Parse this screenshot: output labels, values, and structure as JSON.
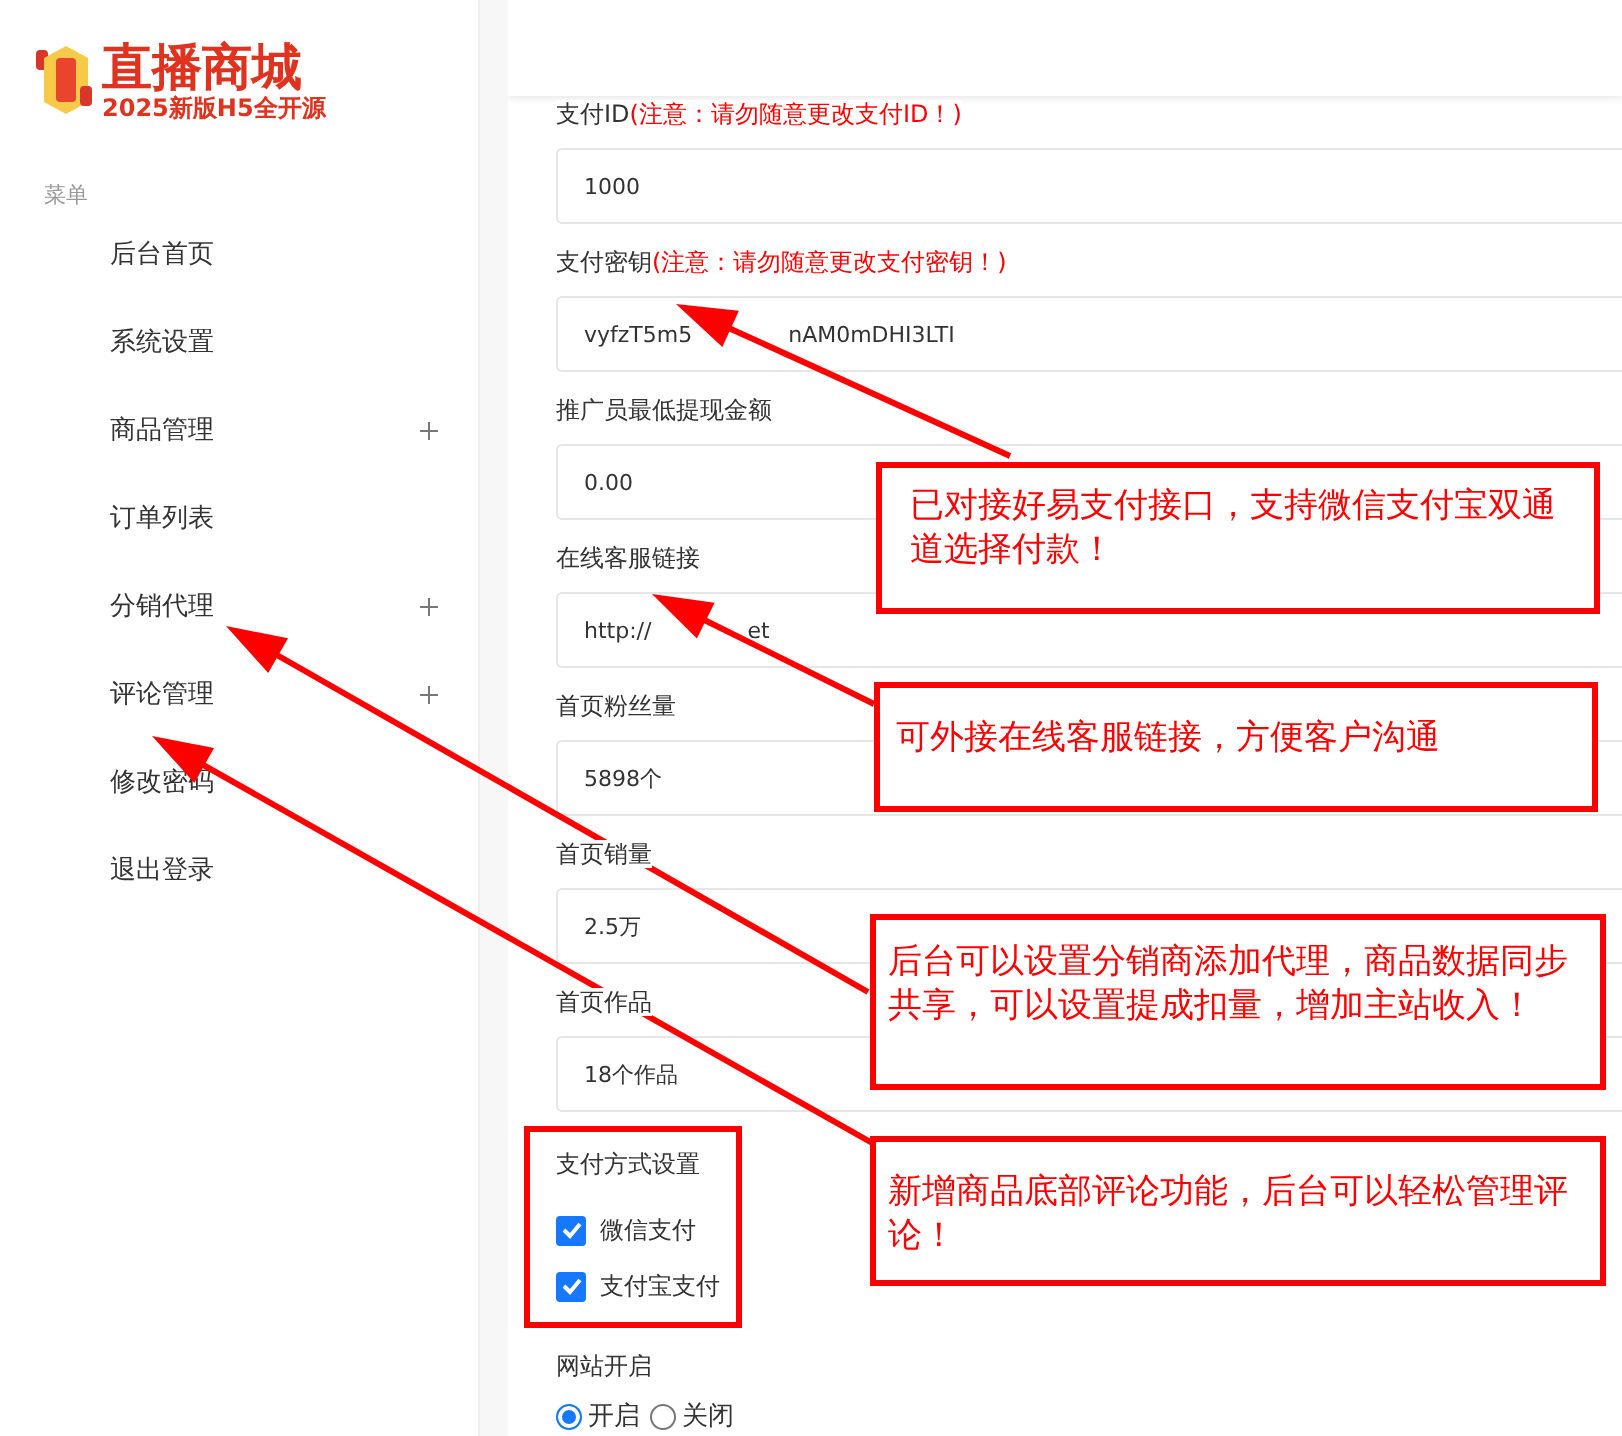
{
  "logo": {
    "title": "直播商城",
    "subtitle": "2025新版H5全开源"
  },
  "sidebar": {
    "heading": "菜单",
    "items": [
      {
        "label": "后台首页",
        "expandable": false
      },
      {
        "label": "系统设置",
        "expandable": false
      },
      {
        "label": "商品管理",
        "expandable": true
      },
      {
        "label": "订单列表",
        "expandable": false
      },
      {
        "label": "分销代理",
        "expandable": true
      },
      {
        "label": "评论管理",
        "expandable": true
      },
      {
        "label": "修改密码",
        "expandable": false
      },
      {
        "label": "退出登录",
        "expandable": false
      }
    ]
  },
  "form": {
    "fields": [
      {
        "label": "支付ID",
        "note": "(注意：请勿随意更改支付ID！)",
        "value_parts": [
          "1000"
        ]
      },
      {
        "label": "支付密钥",
        "note": "(注意：请勿随意更改支付密钥！)",
        "value_parts": [
          "vyfzT5m5",
          "nAM0mDHI3LTI"
        ]
      },
      {
        "label": "推广员最低提现金额",
        "value_parts": [
          "0.00"
        ]
      },
      {
        "label": "在线客服链接",
        "value_parts": [
          "http://",
          "et"
        ]
      },
      {
        "label": "首页粉丝量",
        "value_parts": [
          "5898个"
        ]
      },
      {
        "label": "首页销量",
        "value_parts": [
          "2.5万"
        ]
      },
      {
        "label": "首页作品",
        "value_parts": [
          "18个作品"
        ]
      }
    ],
    "payment": {
      "label": "支付方式设置",
      "options": [
        {
          "label": "微信支付",
          "checked": true
        },
        {
          "label": "支付宝支付",
          "checked": true
        }
      ]
    },
    "site": {
      "label": "网站开启",
      "options": [
        {
          "label": "开启",
          "selected": true
        },
        {
          "label": "关闭",
          "selected": false
        }
      ]
    }
  },
  "annotations": [
    {
      "text": "已对接好易支付接口，支持微信支付宝双通道选择付款！"
    },
    {
      "text": "可外接在线客服链接，方便客户沟通"
    },
    {
      "text": "后台可以设置分销商添加代理，商品数据同步共享，可以设置提成扣量，增加主站收入！"
    },
    {
      "text": "新增商品底部评论功能，后台可以轻松管理评论！"
    }
  ]
}
